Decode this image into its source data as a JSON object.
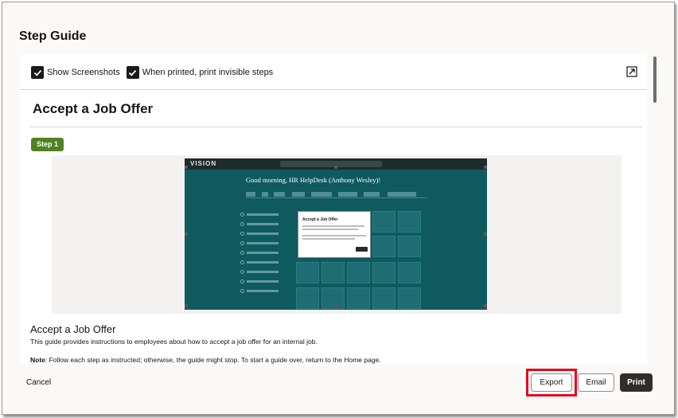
{
  "dialog": {
    "title": "Step Guide"
  },
  "options": {
    "show_screenshots_label": "Show Screenshots",
    "show_screenshots_checked": true,
    "print_invisible_label": "When printed, print invisible steps",
    "print_invisible_checked": true
  },
  "guide": {
    "title": "Accept a Job Offer",
    "step_badge": "Step 1",
    "step_heading": "Accept a Job Offer",
    "step_description": "This guide provides instructions to employees about how to accept a job offer for an internal job.",
    "note_label": "Note",
    "note_text": ": Follow each step as instructed; otherwise, the guide might stop. To start a guide over, return to the Home page."
  },
  "screenshot": {
    "app_logo": "VISION",
    "greeting": "Good morning, HR HelpDesk (Anthony Wesley)!",
    "popup_title": "Accept a Job Offer"
  },
  "footer": {
    "cancel_label": "Cancel",
    "export_label": "Export",
    "email_label": "Email",
    "print_label": "Print"
  },
  "colors": {
    "step_badge": "#508223",
    "print_button": "#312d2a",
    "highlight": "#e3081a"
  }
}
